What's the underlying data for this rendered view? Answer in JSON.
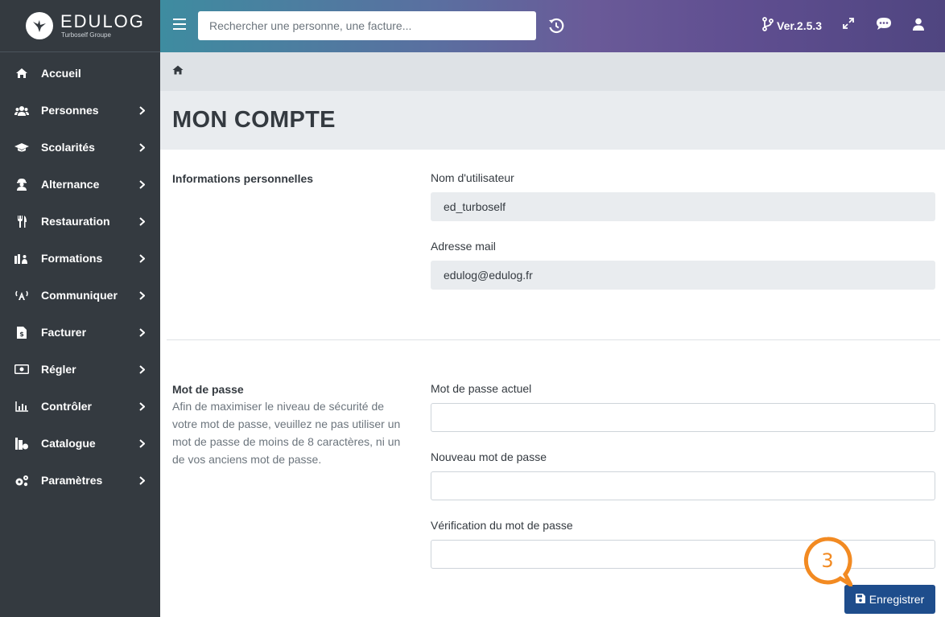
{
  "brand": {
    "name": "EDULOG",
    "subtitle": "Turboself Groupe"
  },
  "topbar": {
    "search_placeholder": "Rechercher une personne, une facture...",
    "version": "Ver.2.5.3"
  },
  "sidebar": {
    "items": [
      {
        "label": "Accueil",
        "icon": "home-icon",
        "has_children": false
      },
      {
        "label": "Personnes",
        "icon": "users-icon",
        "has_children": true
      },
      {
        "label": "Scolarités",
        "icon": "graduation-cap-icon",
        "has_children": true
      },
      {
        "label": "Alternance",
        "icon": "worker-icon",
        "has_children": true
      },
      {
        "label": "Restauration",
        "icon": "utensils-icon",
        "has_children": true
      },
      {
        "label": "Formations",
        "icon": "classroom-icon",
        "has_children": true
      },
      {
        "label": "Communiquer",
        "icon": "broadcast-icon",
        "has_children": true
      },
      {
        "label": "Facturer",
        "icon": "invoice-icon",
        "has_children": true
      },
      {
        "label": "Régler",
        "icon": "money-icon",
        "has_children": true
      },
      {
        "label": "Contrôler",
        "icon": "chart-icon",
        "has_children": true
      },
      {
        "label": "Catalogue",
        "icon": "catalogue-icon",
        "has_children": true
      },
      {
        "label": "Paramètres",
        "icon": "gears-icon",
        "has_children": true
      }
    ]
  },
  "page": {
    "title": "MON COMPTE"
  },
  "personal": {
    "title": "Informations personnelles",
    "username_label": "Nom d'utilisateur",
    "username_value": "ed_turboself",
    "email_label": "Adresse mail",
    "email_value": "edulog@edulog.fr"
  },
  "password": {
    "title": "Mot de passe",
    "description": "Afin de maximiser le niveau de sécurité de votre mot de passe, veuillez ne pas utiliser un mot de passe de moins de 8 caractères, ni un de vos anciens mot de passe.",
    "current_label": "Mot de passe actuel",
    "new_label": "Nouveau mot de passe",
    "confirm_label": "Vérification du mot de passe"
  },
  "actions": {
    "save_label": "Enregistrer"
  },
  "callout": {
    "number": "3",
    "color": "#f28a22"
  },
  "colors": {
    "sidebar_bg": "#343a40",
    "save_button": "#1e4d8c"
  }
}
